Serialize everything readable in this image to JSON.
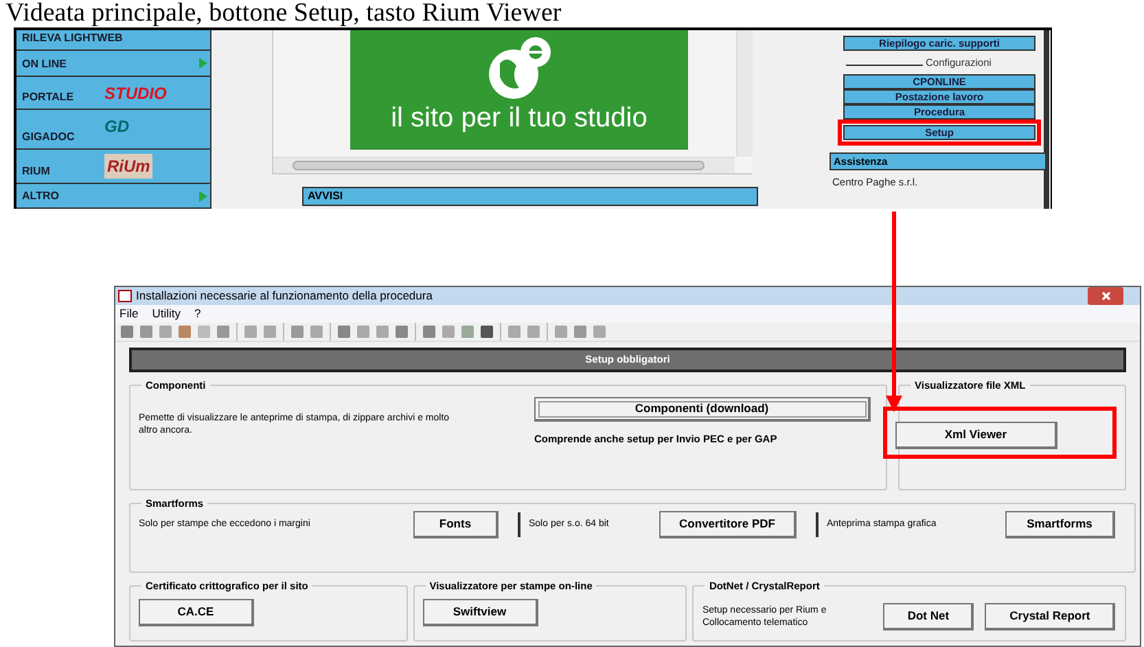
{
  "caption": "Videata principale, bottone Setup, tasto Rium Viewer",
  "main_window": {
    "menu_items": [
      {
        "label": "RILEVA LIGHTWEB",
        "has_submenu": false
      },
      {
        "label": "ON LINE",
        "has_submenu": true
      },
      {
        "label": "PORTALE",
        "has_submenu": false,
        "logo": "STUDIO"
      },
      {
        "label": "GIGADOC",
        "has_submenu": false,
        "logo": "GD"
      },
      {
        "label": "RIUM",
        "has_submenu": false,
        "logo": "RiUm"
      },
      {
        "label": "ALTRO",
        "has_submenu": true
      }
    ],
    "banner_text": "il sito per il tuo studio",
    "notices_title": "AVVISI",
    "summary_button": "Riepilogo caric. supporti",
    "configurations_label": "Configurazioni",
    "config_buttons": [
      {
        "label": "CPONLINE",
        "highlighted": false
      },
      {
        "label": "Postazione lavoro",
        "highlighted": false
      },
      {
        "label": "Procedura",
        "highlighted": false
      },
      {
        "label": "Setup",
        "highlighted": true
      }
    ],
    "support_title": "Assistenza",
    "support_lines": [
      "Centro Paghe s.r.l."
    ]
  },
  "dialog": {
    "title": "Installazioni necessarie al funzionamento della procedura",
    "menu": [
      "File",
      "Utility",
      "?"
    ],
    "section_header": "Setup obbligatori",
    "components": {
      "title": "Componenti",
      "description": "Pemette di visualizzare le anteprime di stampa, di zippare archivi e molto altro ancora.",
      "button": "Componenti (download)",
      "note": "Comprende anche setup per Invio PEC e per GAP"
    },
    "xml": {
      "title": "Visualizzatore file XML",
      "button": "Xml Viewer",
      "highlighted": true
    },
    "smartforms": {
      "title": "Smartforms",
      "items": [
        {
          "text": "Solo per stampe che eccedono i margini",
          "button": "Fonts"
        },
        {
          "text": "Solo per s.o. 64 bit",
          "button": "Convertitore PDF"
        },
        {
          "text": "Anteprima stampa grafica",
          "button": "Smartforms"
        }
      ]
    },
    "certificate": {
      "title": "Certificato crittografico per il sito",
      "button": "CA.CE"
    },
    "viewer": {
      "title": "Visualizzatore per stampe on-line",
      "button": "Swiftview"
    },
    "dotnet": {
      "title": "DotNet / CrystalReport",
      "text": "Setup necessario per Rium e Collocamento telematico",
      "buttons": [
        "Dot Net",
        "Crystal Report"
      ]
    }
  }
}
